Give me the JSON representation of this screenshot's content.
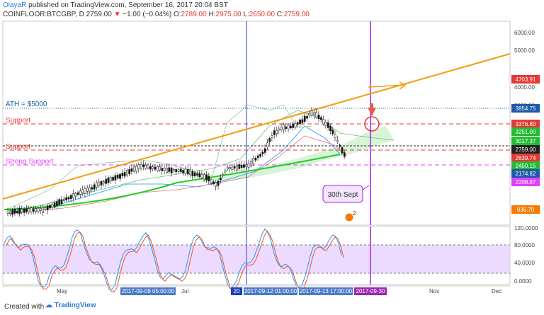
{
  "header": {
    "author": "OlayaR",
    "published": " published on TradingView.com, September 16, 2017 20:04 BST",
    "symbol": "COINFLOOR:BTCGBP, D",
    "price": "2759.00",
    "change": "−1.00 (−0.04%)",
    "open_label": "O:",
    "open": "2789.00",
    "high_label": "H:",
    "high": "2975.00",
    "low_label": "L:",
    "low": "2650.00",
    "close_label": "C:",
    "close": "2759.00"
  },
  "annotations": {
    "ath": "ATH = $5000",
    "support1": "Support",
    "support2": "Support",
    "strong_support": "Strong Support",
    "callout": "30th Sept",
    "badge": "2"
  },
  "price_axis": {
    "ticks": [
      "6000.00",
      "5000.00",
      "4000.00",
      "3000.00"
    ],
    "markers": [
      {
        "text": "4703.91",
        "color": "#e53935"
      },
      {
        "text": "3854.75",
        "color": "#1e5aa8"
      },
      {
        "text": "3376.80",
        "color": "#e53935"
      },
      {
        "text": "3251.00",
        "color": "#22bb33"
      },
      {
        "text": "3017.37",
        "color": "#22bb33"
      },
      {
        "text": "2759.00",
        "color": "#222222"
      },
      {
        "text": "2639.74",
        "color": "#e53935"
      },
      {
        "text": "2450.15",
        "color": "#22bb33"
      },
      {
        "text": "2174.82",
        "color": "#1e5aa8"
      },
      {
        "text": "2208.87",
        "color": "#e040fb"
      },
      {
        "text": "936.70",
        "color": "#f57c00"
      }
    ]
  },
  "osc_axis": {
    "ticks": [
      "120.0000",
      "80.0000",
      "40.0000",
      "0.0000"
    ]
  },
  "time_axis": {
    "labels": [
      "May",
      "Jul",
      "Nov",
      "Dec"
    ],
    "highlights": [
      {
        "text": "2017-09-09 05:00:00",
        "color": "#4a7bc8"
      },
      {
        "text": "20",
        "color": "#1a3fbf"
      },
      {
        "text": "2017-09-12 01:00:00",
        "color": "#4a7bc8"
      },
      {
        "text": "2017-09-13 17:00:00",
        "color": "#4a7bc8"
      },
      {
        "text": "2017-09-30",
        "color": "#9c27b0"
      }
    ]
  },
  "footer": {
    "made_with": "Created with",
    "brand": "TradingView"
  },
  "colors": {
    "trend": "#f39c12",
    "support": "#e53935",
    "strong": "#e040fb",
    "ma": "#22cc22",
    "blue_line": "#4a5bd6",
    "purple_line": "#a020f0"
  }
}
